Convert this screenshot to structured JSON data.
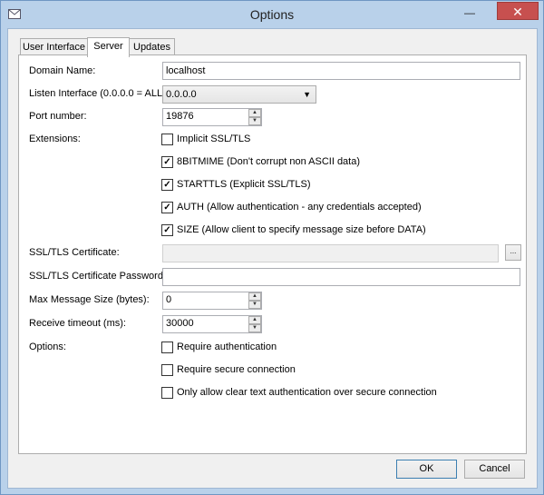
{
  "window": {
    "title": "Options",
    "minimize_glyph": "—",
    "close_glyph": "✕",
    "icon": "app-icon"
  },
  "tabs": [
    {
      "label": "User Interface",
      "active": false
    },
    {
      "label": "Server",
      "active": true
    },
    {
      "label": "Updates",
      "active": false
    }
  ],
  "form": {
    "domain_name": {
      "label": "Domain Name:",
      "value": "localhost"
    },
    "listen_interface": {
      "label": "Listen Interface (0.0.0.0 = ALL):",
      "value": "0.0.0.0"
    },
    "port_number": {
      "label": "Port number:",
      "value": "19876"
    },
    "extensions": {
      "label": "Extensions:",
      "items": [
        {
          "label": "Implicit SSL/TLS",
          "checked": false
        },
        {
          "label": "8BITMIME (Don't corrupt non ASCII data)",
          "checked": true
        },
        {
          "label": "STARTTLS (Explicit SSL/TLS)",
          "checked": true
        },
        {
          "label": "AUTH (Allow authentication - any credentials accepted)",
          "checked": true
        },
        {
          "label": "SIZE (Allow client to specify message size before DATA)",
          "checked": true
        }
      ]
    },
    "ssl_certificate": {
      "label": "SSL/TLS Certificate:",
      "value": "",
      "browse_label": "..."
    },
    "ssl_certificate_password": {
      "label": "SSL/TLS Certificate Password:",
      "value": ""
    },
    "max_message_size": {
      "label": "Max Message Size (bytes):",
      "value": "0"
    },
    "receive_timeout": {
      "label": "Receive timeout (ms):",
      "value": "30000"
    },
    "options": {
      "label": "Options:",
      "items": [
        {
          "label": "Require authentication",
          "checked": false
        },
        {
          "label": "Require secure connection",
          "checked": false
        },
        {
          "label": "Only allow clear text authentication over secure connection",
          "checked": false
        }
      ]
    }
  },
  "buttons": {
    "ok": "OK",
    "cancel": "Cancel"
  },
  "colors": {
    "frame": "#b9d1ea",
    "close": "#c7504f",
    "client": "#f0f0f0"
  }
}
